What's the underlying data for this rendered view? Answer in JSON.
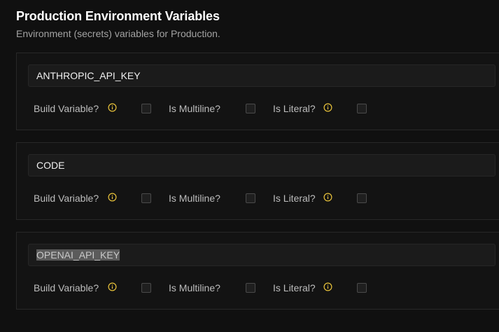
{
  "header": {
    "title": "Production Environment Variables",
    "subtitle": "Environment (secrets) variables for Production."
  },
  "variables": [
    {
      "key": "ANTHROPIC_API_KEY",
      "build_label": "Build Variable?",
      "multiline_label": "Is Multiline?",
      "literal_label": "Is Literal?",
      "build_checked": false,
      "multiline_checked": false,
      "literal_checked": false
    },
    {
      "key": "CODE",
      "build_label": "Build Variable?",
      "multiline_label": "Is Multiline?",
      "literal_label": "Is Literal?",
      "build_checked": false,
      "multiline_checked": false,
      "literal_checked": false
    },
    {
      "key": "OPENAI_API_KEY",
      "build_label": "Build Variable?",
      "multiline_label": "Is Multiline?",
      "literal_label": "Is Literal?",
      "build_checked": false,
      "multiline_checked": false,
      "literal_checked": false
    }
  ],
  "icons": {
    "info": "info-circle-icon"
  },
  "colors": {
    "info_icon": "#e8c23a",
    "background": "#101010"
  }
}
